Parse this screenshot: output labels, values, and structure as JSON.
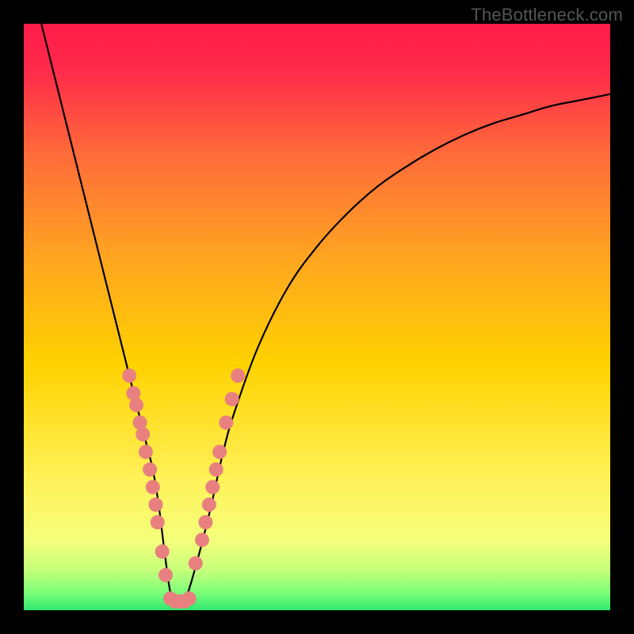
{
  "watermark": "TheBottleneck.com",
  "chart_data": {
    "type": "line",
    "title": "",
    "xlabel": "",
    "ylabel": "",
    "xlim": [
      0,
      100
    ],
    "ylim": [
      0,
      100
    ],
    "background_gradient": {
      "top_color": "#ff1c4a",
      "mid_color": "#ffd200",
      "bottom_color": "#2ee86f"
    },
    "curve_black": {
      "name": "bottleneck-curve",
      "x": [
        3,
        4,
        5,
        6,
        8,
        10,
        12,
        14,
        16,
        18,
        19,
        20,
        21,
        22,
        23,
        24,
        25,
        26,
        27,
        28,
        30,
        32,
        34,
        36,
        40,
        45,
        50,
        55,
        60,
        65,
        70,
        75,
        80,
        85,
        90,
        95,
        100
      ],
      "y": [
        100,
        96,
        92,
        88,
        80,
        72,
        64,
        56,
        48,
        40,
        36,
        32,
        28,
        24,
        18,
        10,
        3,
        1,
        1,
        3,
        10,
        18,
        27,
        34,
        45,
        55,
        62,
        67.5,
        72,
        75.5,
        78.5,
        81,
        83,
        84.5,
        86,
        87,
        88
      ]
    },
    "series_dots_left": {
      "name": "left-branch-markers",
      "color": "#e98080",
      "points": [
        {
          "x": 18.0,
          "y": 40
        },
        {
          "x": 18.7,
          "y": 37
        },
        {
          "x": 19.2,
          "y": 35
        },
        {
          "x": 19.8,
          "y": 32
        },
        {
          "x": 20.3,
          "y": 30
        },
        {
          "x": 20.8,
          "y": 27
        },
        {
          "x": 21.5,
          "y": 24
        },
        {
          "x": 22.0,
          "y": 21
        },
        {
          "x": 22.5,
          "y": 18
        },
        {
          "x": 22.8,
          "y": 15
        },
        {
          "x": 23.6,
          "y": 10
        },
        {
          "x": 24.2,
          "y": 6
        }
      ]
    },
    "series_dots_right": {
      "name": "right-branch-markers",
      "color": "#e98080",
      "points": [
        {
          "x": 29.3,
          "y": 8
        },
        {
          "x": 30.4,
          "y": 12
        },
        {
          "x": 31.0,
          "y": 15
        },
        {
          "x": 31.6,
          "y": 18
        },
        {
          "x": 32.2,
          "y": 21
        },
        {
          "x": 32.8,
          "y": 24
        },
        {
          "x": 33.4,
          "y": 27
        },
        {
          "x": 34.5,
          "y": 32
        },
        {
          "x": 35.5,
          "y": 36
        },
        {
          "x": 36.5,
          "y": 40
        }
      ]
    },
    "series_dots_bottom": {
      "name": "trough-markers",
      "color": "#e98080",
      "points": [
        {
          "x": 25.0,
          "y": 2.0
        },
        {
          "x": 25.8,
          "y": 1.5
        },
        {
          "x": 26.6,
          "y": 1.5
        },
        {
          "x": 27.4,
          "y": 1.5
        },
        {
          "x": 28.2,
          "y": 2.0
        }
      ]
    },
    "plot_frame": {
      "border_color": "#000000",
      "border_width_px": 30
    }
  }
}
